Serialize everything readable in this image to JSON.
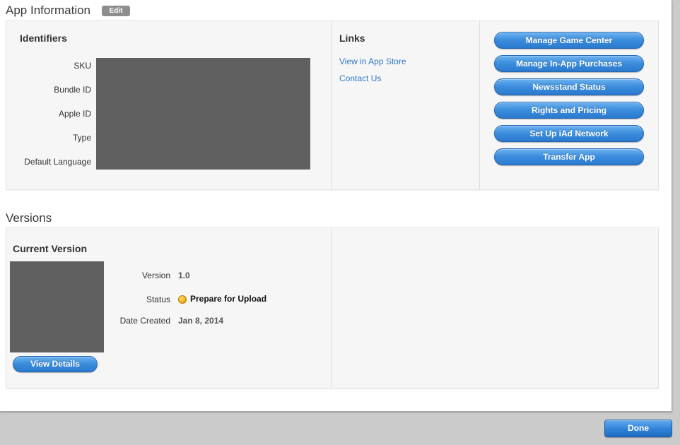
{
  "app_info": {
    "title": "App Information",
    "edit_label": "Edit",
    "identifiers": {
      "heading": "Identifiers",
      "labels": [
        "SKU",
        "Bundle ID",
        "Apple ID",
        "Type",
        "Default Language"
      ]
    },
    "links": {
      "heading": "Links",
      "items": [
        "View in App Store",
        "Contact Us"
      ]
    },
    "actions": [
      "Manage Game Center",
      "Manage In-App Purchases",
      "Newsstand Status",
      "Rights and Pricing",
      "Set Up iAd Network",
      "Transfer App"
    ]
  },
  "versions": {
    "title": "Versions",
    "current": {
      "heading": "Current Version",
      "version_label": "Version",
      "version_value": "1.0",
      "status_label": "Status",
      "status_value": "Prepare for Upload",
      "date_label": "Date Created",
      "date_value": "Jan 8, 2014",
      "view_details_label": "View Details"
    }
  },
  "footer": {
    "done_label": "Done"
  },
  "colors": {
    "link": "#2c79c4",
    "button_blue": "#3d8fde",
    "status_dot": "#f0a500",
    "redaction": "#606060"
  }
}
